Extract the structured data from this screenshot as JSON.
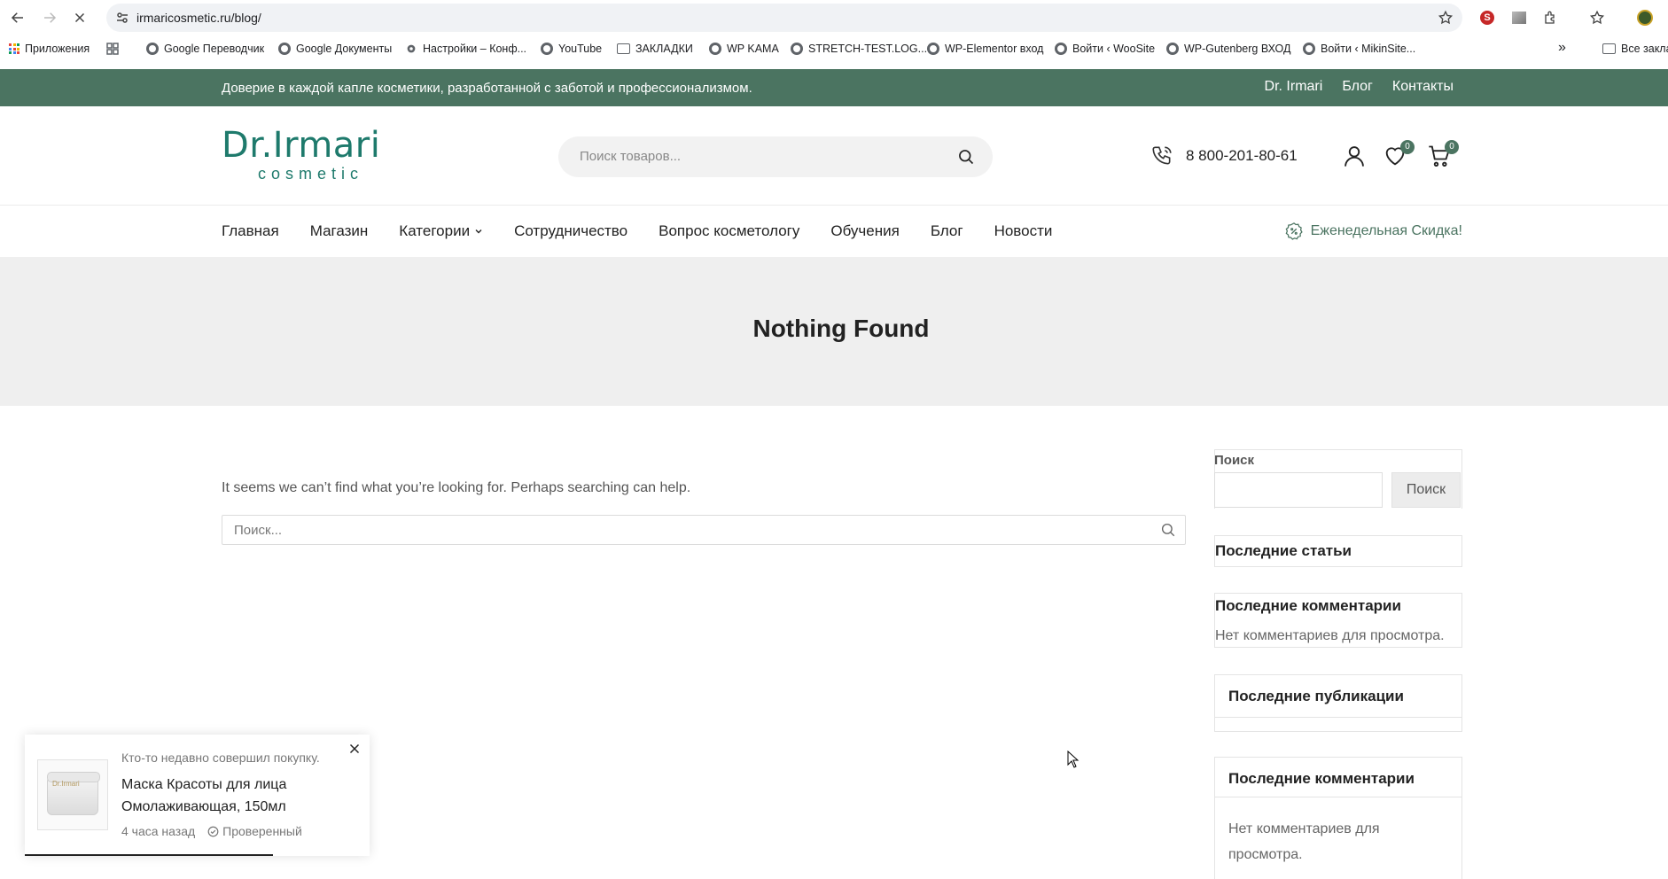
{
  "browser": {
    "url": "irmaricosmetic.ru/blog/",
    "bookmarks": [
      "Приложения",
      "Google Переводчик",
      "Google Документы",
      "Настройки – Конф...",
      "YouTube",
      "ЗАКЛАДКИ",
      "WP KAMA",
      "STRETCH-TEST.LOG...",
      "WP-Elementor вход",
      "Войти ‹ WooSite",
      "WP-Gutenberg ВХОД",
      "Войти ‹ MikinSite...",
      "Все заклад"
    ]
  },
  "topbar": {
    "tagline": "Доверие в каждой капле косметики, разработанной с заботой и профессионализмом.",
    "links": [
      "Dr. Irmari",
      "Блог",
      "Контакты"
    ]
  },
  "header": {
    "logo_main": "Dr.Irmari",
    "logo_sub": "cosmetic",
    "search_placeholder": "Поиск товаров...",
    "phone": "8 800-201-80-61",
    "wishlist_count": "0",
    "cart_count": "0"
  },
  "nav": {
    "items": [
      "Главная",
      "Магазин",
      "Категории",
      "Сотрудничество",
      "Вопрос косметологу",
      "Обучения",
      "Блог",
      "Новости"
    ],
    "promo": "Еженедельная Скидка!"
  },
  "hero": {
    "title": "Nothing Found"
  },
  "content": {
    "message": "It seems we can’t find what you’re looking for. Perhaps searching can help.",
    "search_placeholder": "Поиск..."
  },
  "sidebar": {
    "search_label": "Поиск",
    "search_button": "Поиск",
    "recent_posts_title": "Последние статьи",
    "recent_comments_title": "Последние комментарии",
    "recent_comments_text": "Нет комментариев для просмотра.",
    "recent_pubs_title": "Последние публикации",
    "recent_comments2_title": "Последние комментарии",
    "recent_comments2_text": "Нет комментариев для просмотра."
  },
  "toast": {
    "intro": "Кто-то недавно совершил покупку.",
    "product": "Маска Красоты для лица Омолаживающая, 150мл",
    "time": "4 часа назад",
    "verified": "Проверенный",
    "thumb_label": "Dr.Irmari",
    "progress": 0.72
  },
  "colors": {
    "brand_green": "#4b7461",
    "logo_teal": "#1e7a6c",
    "hero_bg": "#efefef"
  }
}
